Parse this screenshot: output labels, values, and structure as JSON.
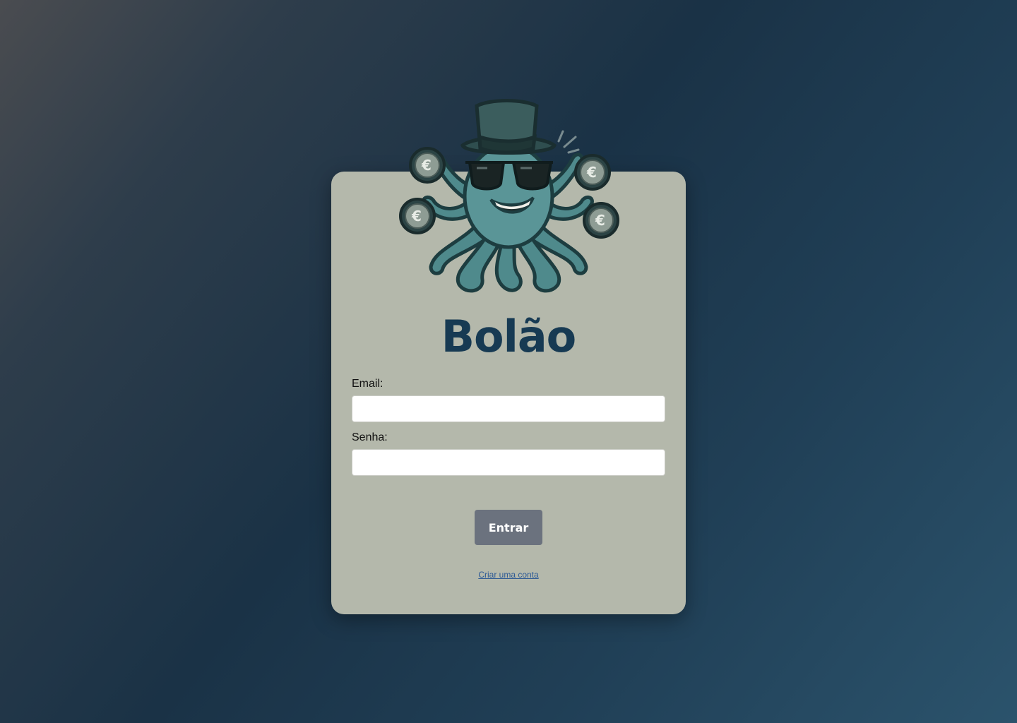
{
  "brand": {
    "title": "Bolão",
    "mascot_icon": "octopus-with-top-hat-and-euro-coins-icon",
    "title_color": "#173a53"
  },
  "form": {
    "email_label": "Email:",
    "email_value": "",
    "email_placeholder": "",
    "password_label": "Senha:",
    "password_value": "",
    "password_placeholder": "",
    "submit_label": "Entrar",
    "signup_link": "Criar uma conta"
  },
  "colors": {
    "card_background": "#b4b8ab",
    "button_background": "#6b727e",
    "link": "#2d5a95"
  }
}
